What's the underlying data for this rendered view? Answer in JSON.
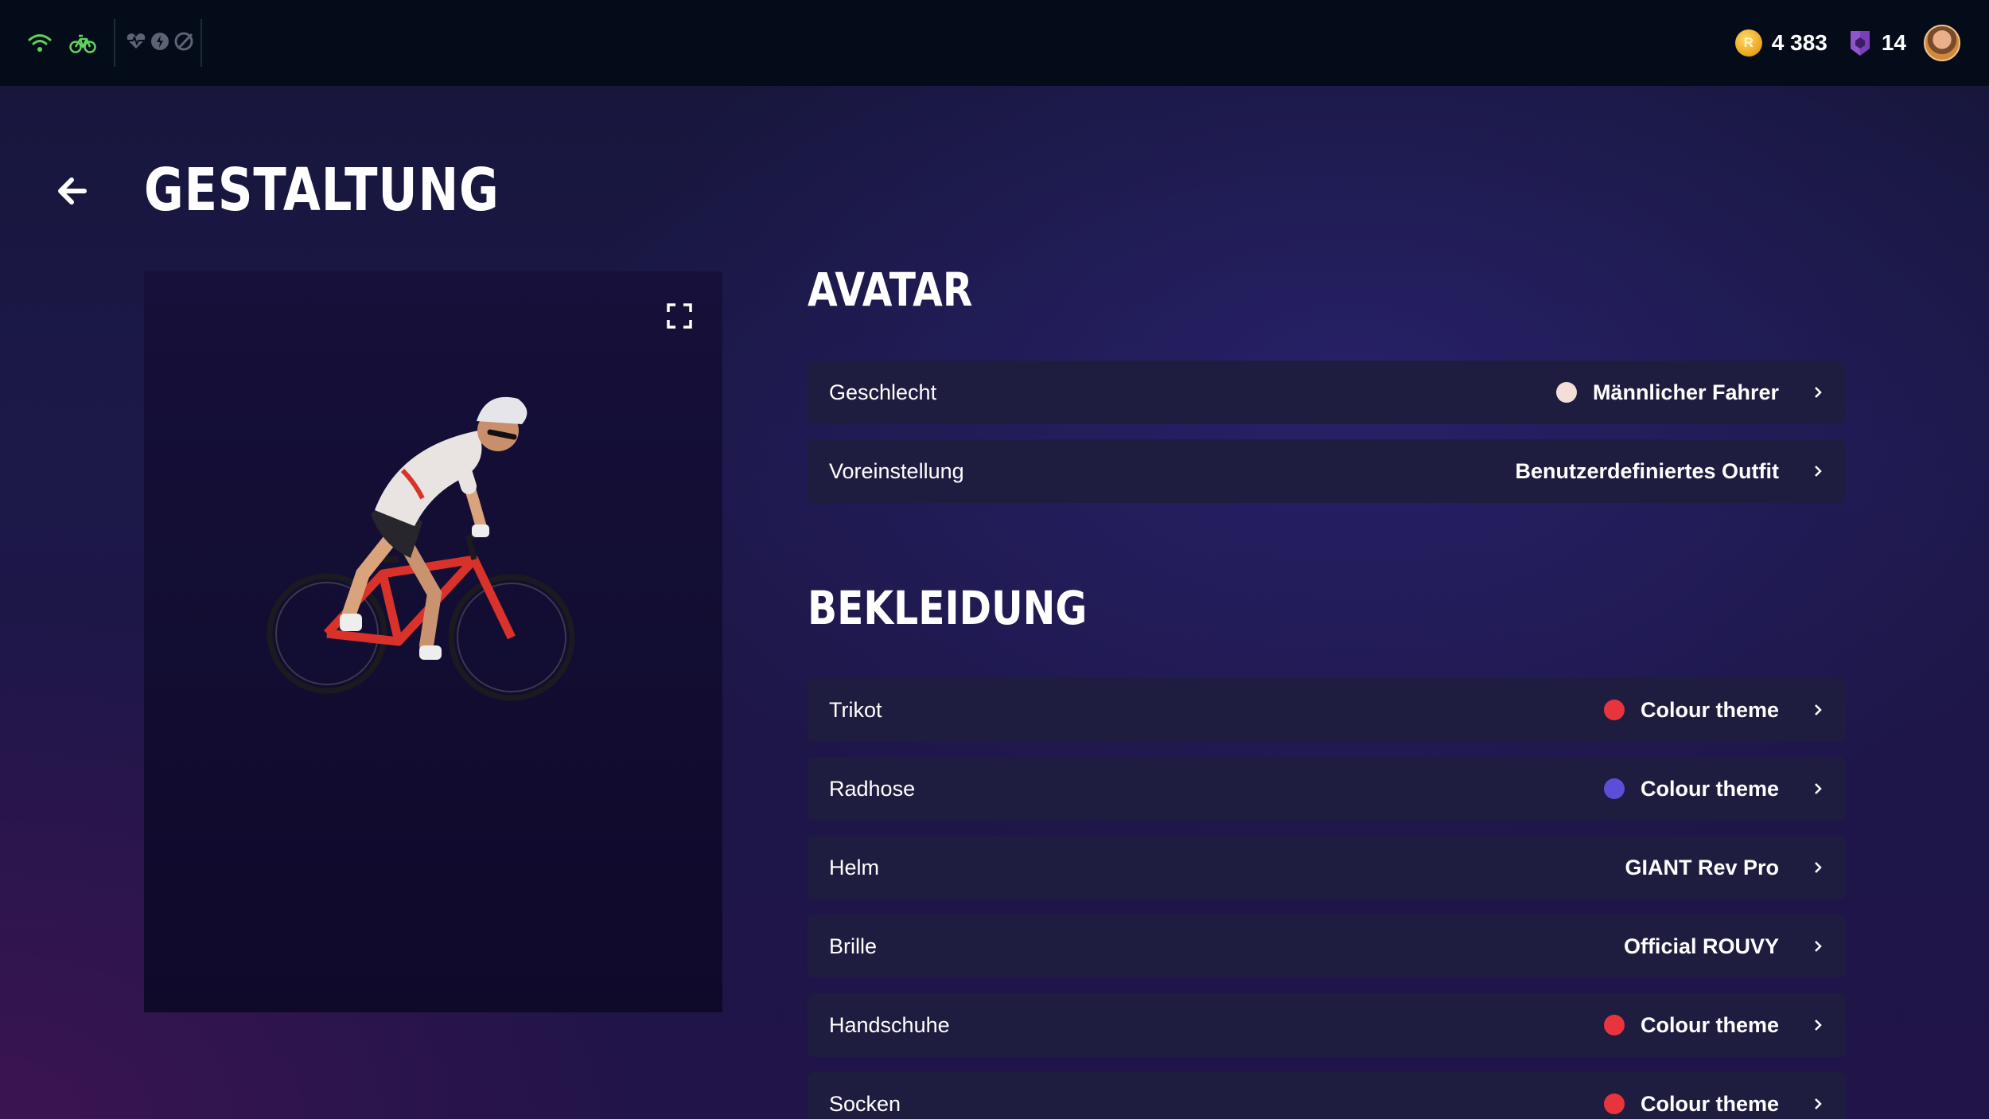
{
  "topbar": {
    "coins": "4 383",
    "badges": "14",
    "colors": {
      "wifi": "#5fd35a",
      "bike": "#5fd35a",
      "sensor_inactive": "#6b7280",
      "coin": "#f0b428",
      "badge": "#7a3fb8"
    }
  },
  "header": {
    "title": "GESTALTUNG"
  },
  "avatar_section": {
    "title": "AVATAR",
    "rows": [
      {
        "label": "Geschlecht",
        "value": "Männlicher Fahrer",
        "swatch": "#f3ded8"
      },
      {
        "label": "Voreinstellung",
        "value": "Benutzerdefiniertes Outfit",
        "swatch": null
      }
    ]
  },
  "clothing_section": {
    "title": "BEKLEIDUNG",
    "rows": [
      {
        "label": "Trikot",
        "value": "Colour theme",
        "swatch": "#e8343c"
      },
      {
        "label": "Radhose",
        "value": "Colour theme",
        "swatch": "#5a4fd6"
      },
      {
        "label": "Helm",
        "value": "GIANT Rev Pro",
        "swatch": null
      },
      {
        "label": "Brille",
        "value": "Official ROUVY",
        "swatch": null
      },
      {
        "label": "Handschuhe",
        "value": "Colour theme",
        "swatch": "#e8343c"
      },
      {
        "label": "Socken",
        "value": "Colour theme",
        "swatch": "#e8343c"
      }
    ]
  }
}
